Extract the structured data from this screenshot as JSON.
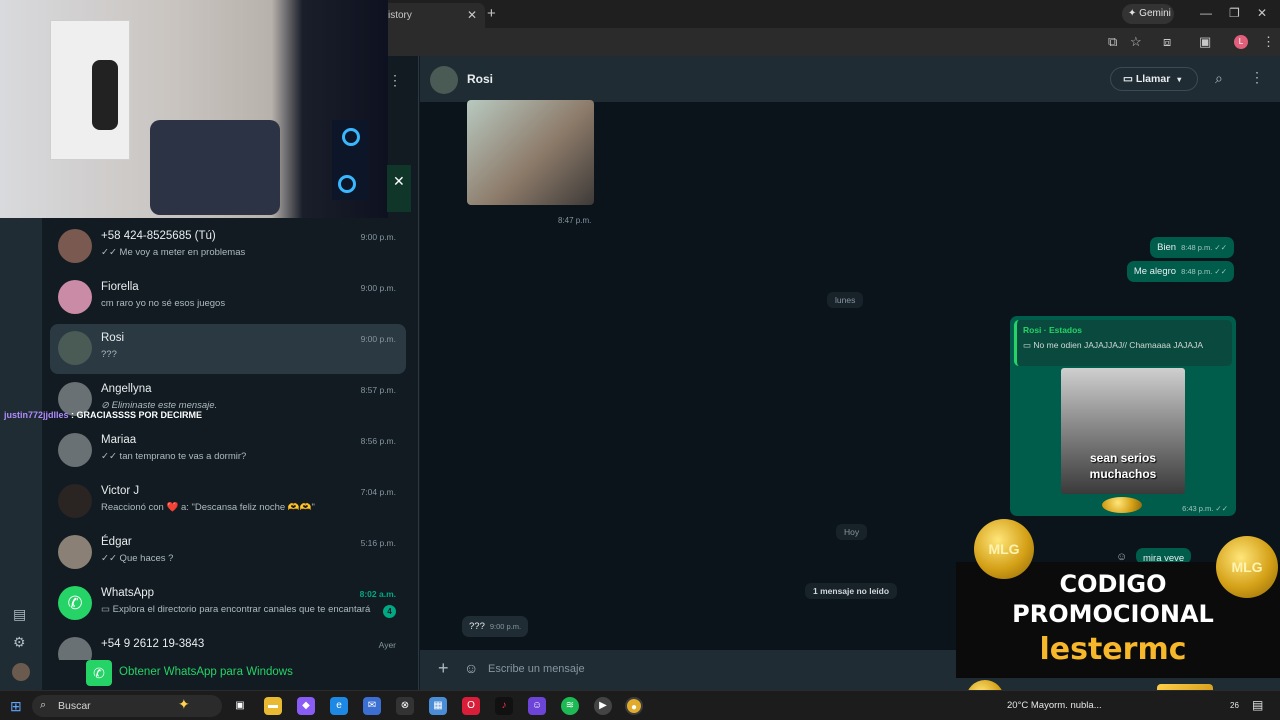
{
  "browser": {
    "tab_title": "istory",
    "gemini_label": "Gemini",
    "profile_initial": "L"
  },
  "stream": {
    "chat_user": "justin772jjdlles",
    "chat_text": ": GRACIASSSS POR DECIRME",
    "promo_line1": "CODIGO",
    "promo_line2": "PROMOCIONAL",
    "promo_code": "lestermc",
    "coin_label": "MLG"
  },
  "chat_list": [
    {
      "name": "+58 424-8525685 (Tú)",
      "message": "✓✓ Me voy a meter en problemas",
      "time": "9:00 p.m."
    },
    {
      "name": "Fiorella",
      "message": "cm raro yo no sé esos juegos",
      "time": "9:00 p.m."
    },
    {
      "name": "Rosi",
      "message": "???",
      "time": "9:00 p.m."
    },
    {
      "name": "Angellyna",
      "message": "⊘ Eliminaste este mensaje.",
      "time": "8:57 p.m."
    },
    {
      "name": "Mariaa",
      "message": "✓✓ tan temprano te vas a dormir?",
      "time": "8:56 p.m."
    },
    {
      "name": "Victor J",
      "message": "Reaccionó con ❤️ a: \"Descansa feliz noche 🫶🫶\"",
      "time": "7:04 p.m."
    },
    {
      "name": "Édgar",
      "message": "✓✓ Que haces ?",
      "time": "5:16 p.m."
    },
    {
      "name": "WhatsApp",
      "message": "▭ Explora el directorio para encontrar canales que te encantarán...",
      "time": "8:02 a.m.",
      "badge": "4"
    },
    {
      "name": "+54 9 2612 19-3843",
      "message": "",
      "time": "Ayer"
    }
  ],
  "get_whatsapp_label": "Obtener WhatsApp para Windows",
  "chat": {
    "contact_name": "Rosi",
    "call_label": "Llamar",
    "image_time": "8:47 p.m.",
    "messages_out": [
      {
        "text": "Bien",
        "time": "8:48 p.m. ✓✓"
      },
      {
        "text": "Me alegro",
        "time": "8:48 p.m. ✓✓"
      }
    ],
    "day_lunes": "lunes",
    "reply": {
      "author": "Rosi · Estados",
      "quoted": "No me odien JAJAJJAJ// Chamaaaa JAJAJA",
      "meme_text": "sean serios muchachos",
      "time": "6:43 p.m. ✓✓"
    },
    "day_hoy": "Hoy",
    "partial_out": "mira veve",
    "unread_label": "1 mensaje no leído",
    "last_in": {
      "text": "???",
      "time": "9:00 p.m."
    },
    "composer_placeholder": "Escribe un mensaje"
  },
  "taskbar": {
    "search_label": "Buscar",
    "weather": "20°C  Mayorm. nubla...",
    "time_fragment": "26"
  }
}
